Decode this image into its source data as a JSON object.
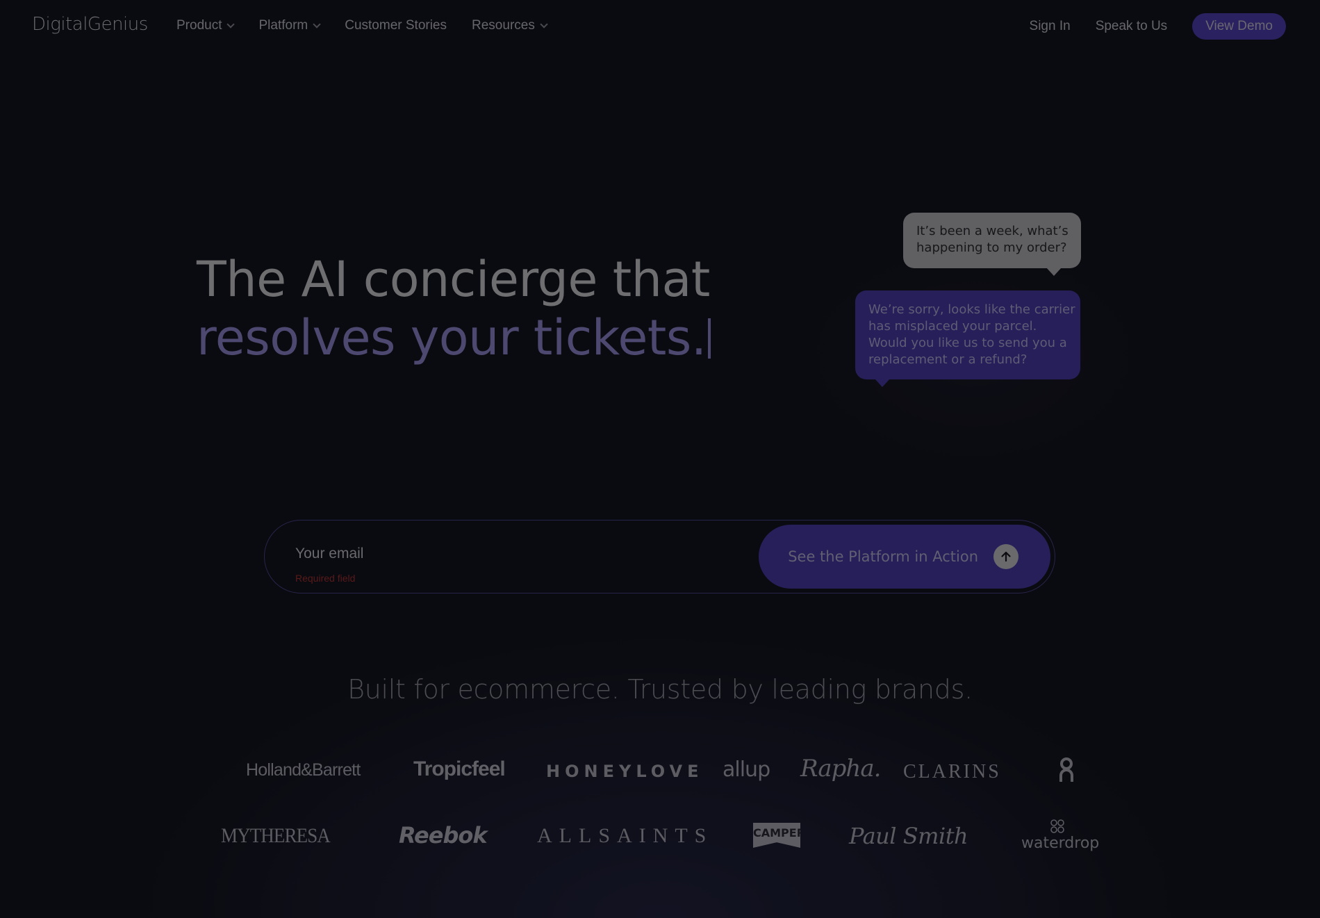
{
  "nav": {
    "logo": "DigitalGenius",
    "items": [
      {
        "label": "Product",
        "has_dropdown": true
      },
      {
        "label": "Platform",
        "has_dropdown": true
      },
      {
        "label": "Customer Stories",
        "has_dropdown": false
      },
      {
        "label": "Resources",
        "has_dropdown": true
      }
    ],
    "sign_in": "Sign In",
    "speak_to_us": "Speak to Us",
    "view_demo": "View Demo"
  },
  "hero": {
    "title_line1": "The AI concierge that",
    "title_line2": "resolves your tickets.",
    "chat": {
      "user_message": [
        "It’s been a week, what’s",
        "happening to my order?"
      ],
      "bot_message": [
        "We’re sorry, looks like the carrier",
        "has misplaced your parcel.",
        "Would you like us to send you a",
        "replacement or a refund?"
      ]
    }
  },
  "form": {
    "email_placeholder": "Your email",
    "email_value": "",
    "validation_message": "Required field",
    "cta_label": "See the Platform in Action",
    "cta_icon": "arrow-up-icon"
  },
  "brands": {
    "title": "Built for ecommerce. Trusted by leading brands.",
    "row1": [
      "Holland&Barrett",
      "Tropicfeel",
      "HONEYLOVE",
      "allup",
      "Rapha.",
      "CLARINS",
      "On"
    ],
    "row2": [
      "MYTHERESA",
      "Reebok",
      "ALLSAINTS",
      "CAMPER",
      "Paul Smith",
      "waterdrop"
    ]
  },
  "colors": {
    "background": "#0a0b10",
    "accent": "#261f5a",
    "accent_text": "#4c4870",
    "error": "#5a1a1a"
  }
}
